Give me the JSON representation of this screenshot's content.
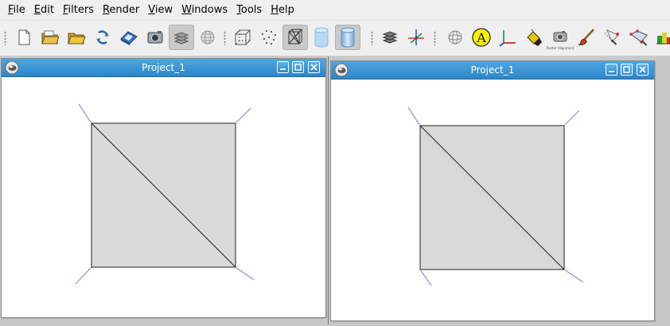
{
  "menu": {
    "items": [
      {
        "label": "File",
        "mnemonic": "F",
        "rest": "ile"
      },
      {
        "label": "Edit",
        "mnemonic": "E",
        "rest": "dit"
      },
      {
        "label": "Filters",
        "mnemonic": "F",
        "rest": "ilters"
      },
      {
        "label": "Render",
        "mnemonic": "R",
        "rest": "ender"
      },
      {
        "label": "View",
        "mnemonic": "V",
        "rest": "iew"
      },
      {
        "label": "Windows",
        "mnemonic": "W",
        "rest": "indows"
      },
      {
        "label": "Tools",
        "mnemonic": "T",
        "rest": "ools"
      },
      {
        "label": "Help",
        "mnemonic": "H",
        "rest": "elp"
      }
    ]
  },
  "toolbar": {
    "buttons": [
      "new-project-icon",
      "open-project-icon",
      "open-mesh-icon",
      "reload-icon",
      "save-icon",
      "snapshot-icon",
      "layers-icon",
      "globe-icon",
      "bounding-box-icon",
      "points-icon",
      "wireframe-icon",
      "flat-cylinder-icon",
      "smooth-cylinder-icon",
      "texture-icon",
      "axes-icon",
      "trackball-icon",
      "annotation-a-icon",
      "axis-xy-icon",
      "paint-bucket-icon",
      "raster-alignment-icon",
      "brush-icon",
      "select-faces-icon",
      "select-vertices-icon",
      "color-select-icon"
    ],
    "active": [
      "layers-icon",
      "wireframe-icon",
      "smooth-cylinder-icon"
    ],
    "raster_alignment_caption": "Raster Alignment"
  },
  "windows": [
    {
      "title": "Project_1"
    },
    {
      "title": "Project_1"
    }
  ],
  "colors": {
    "titlebar": "#3294d6",
    "mesh_face": "#d9d9d9",
    "normal_line": "#8f8fe0"
  }
}
